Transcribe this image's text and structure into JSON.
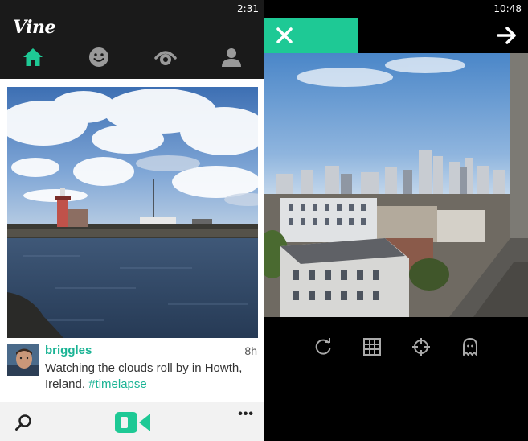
{
  "left": {
    "status_time": "2:31",
    "logo": "Vine",
    "nav": [
      {
        "name": "home",
        "icon": "home-icon",
        "active": true
      },
      {
        "name": "activity",
        "icon": "smiley-icon",
        "active": false
      },
      {
        "name": "explore",
        "icon": "eye-icon",
        "active": false
      },
      {
        "name": "profile",
        "icon": "person-icon",
        "active": false
      }
    ],
    "post": {
      "username": "briggles",
      "time_ago": "8h",
      "caption": "Watching the clouds roll by in Howth, Ireland. ",
      "hashtag": "#timelapse"
    },
    "appbar": {
      "search_icon": "search-icon",
      "camera_icon": "video-camera-icon",
      "more": "•••"
    }
  },
  "right": {
    "status_time": "10:48",
    "close_icon": "close-icon",
    "next_icon": "arrow-right-icon",
    "tools": [
      "refresh-icon",
      "grid-icon",
      "focus-icon",
      "ghost-icon"
    ]
  },
  "colors": {
    "accent": "#1ab394",
    "camera_green": "#1ec995",
    "header_bg": "#1a1a1a"
  }
}
